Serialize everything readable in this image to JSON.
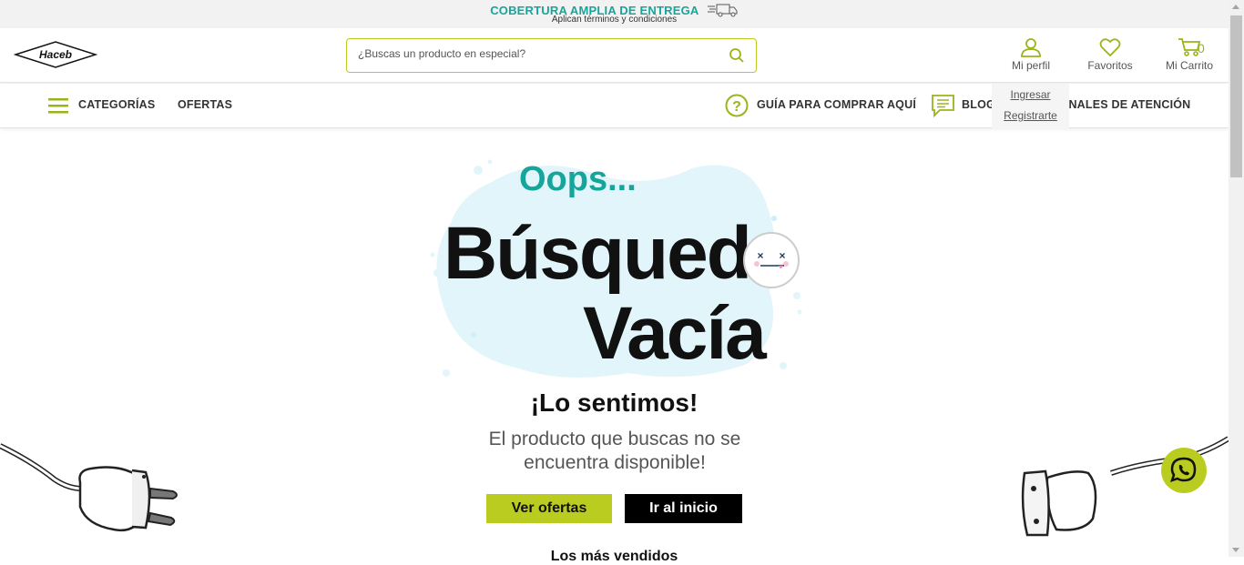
{
  "topbar": {
    "headline": "COBERTURA AMPLIA DE ENTREGA",
    "subline": "Aplican términos y condiciones",
    "truck_icon": "truck-icon"
  },
  "header": {
    "logo_text": "Haceb",
    "search_placeholder": "¿Buscas un producto en especial?",
    "profile_label": "Mi perfil",
    "favorites_label": "Favoritos",
    "cart_label": "Mi Carrito",
    "cart_count": "0"
  },
  "profile_menu": {
    "login": "Ingresar",
    "register": "Registrarte"
  },
  "nav": {
    "categories": "CATEGORÍAS",
    "offers": "OFERTAS",
    "guide": "GUÍA PARA COMPRAR AQUÍ",
    "blog": "BLOG",
    "channels": "CANALES DE ATENCIÓN"
  },
  "main": {
    "oops": "Oops...",
    "title_line1": "Búsqued",
    "title_line2": "Vacía",
    "sorry": "¡Lo sentimos!",
    "message": "El producto que buscas no se encuentra disponible!",
    "btn_offers": "Ver ofertas",
    "btn_home": "Ir al inicio",
    "best_sellers": "Los más vendidos"
  },
  "colors": {
    "accent_green": "#b9cc1f",
    "teal": "#16a59b"
  }
}
